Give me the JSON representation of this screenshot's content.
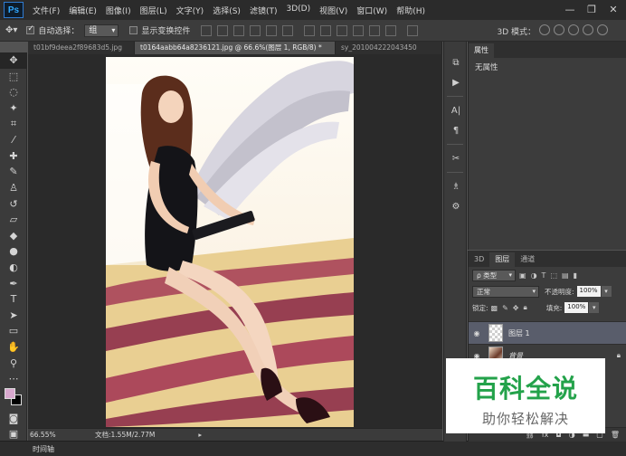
{
  "app": {
    "logo": "Ps"
  },
  "menu": [
    "文件(F)",
    "编辑(E)",
    "图像(I)",
    "图层(L)",
    "文字(Y)",
    "选择(S)",
    "滤镜(T)",
    "3D(D)",
    "视图(V)",
    "窗口(W)",
    "帮助(H)"
  ],
  "window_controls": {
    "minimize": "—",
    "restore": "❐",
    "close": "✕"
  },
  "options": {
    "auto_select_label": "自动选择：",
    "auto_select_value": "组",
    "show_transform_label": "显示变换控件",
    "mode_3d_label": "3D 模式："
  },
  "tabs": [
    {
      "label": "t01bf9deea2f89683d5.jpg",
      "active": false
    },
    {
      "label": "t0164aabb64a8236121.jpg @ 66.6%(图层 1, RGB/8) *",
      "active": true
    },
    {
      "label": "sy_201004222043450",
      "active": false
    }
  ],
  "status": {
    "zoom": "66.55%",
    "doc_info": "文档:1.55M/2.77M"
  },
  "timeline": {
    "label": "时间轴"
  },
  "properties": {
    "tab_label": "属性",
    "empty_text": "无属性"
  },
  "layers": {
    "tabs": [
      "3D",
      "图层",
      "通道"
    ],
    "filter_label": "ρ 类型",
    "blend_mode": "正常",
    "opacity_label": "不透明度:",
    "opacity_value": "100%",
    "lock_label": "锁定:",
    "fill_label": "填充:",
    "fill_value": "100%",
    "items": [
      {
        "name": "图层 1",
        "selected": true
      },
      {
        "name": "背景",
        "selected": false
      }
    ]
  },
  "colors": {
    "foreground": "#d9a9cf",
    "background": "#000000"
  },
  "watermark": {
    "title": "百科全说",
    "subtitle": "助你轻松解决"
  }
}
